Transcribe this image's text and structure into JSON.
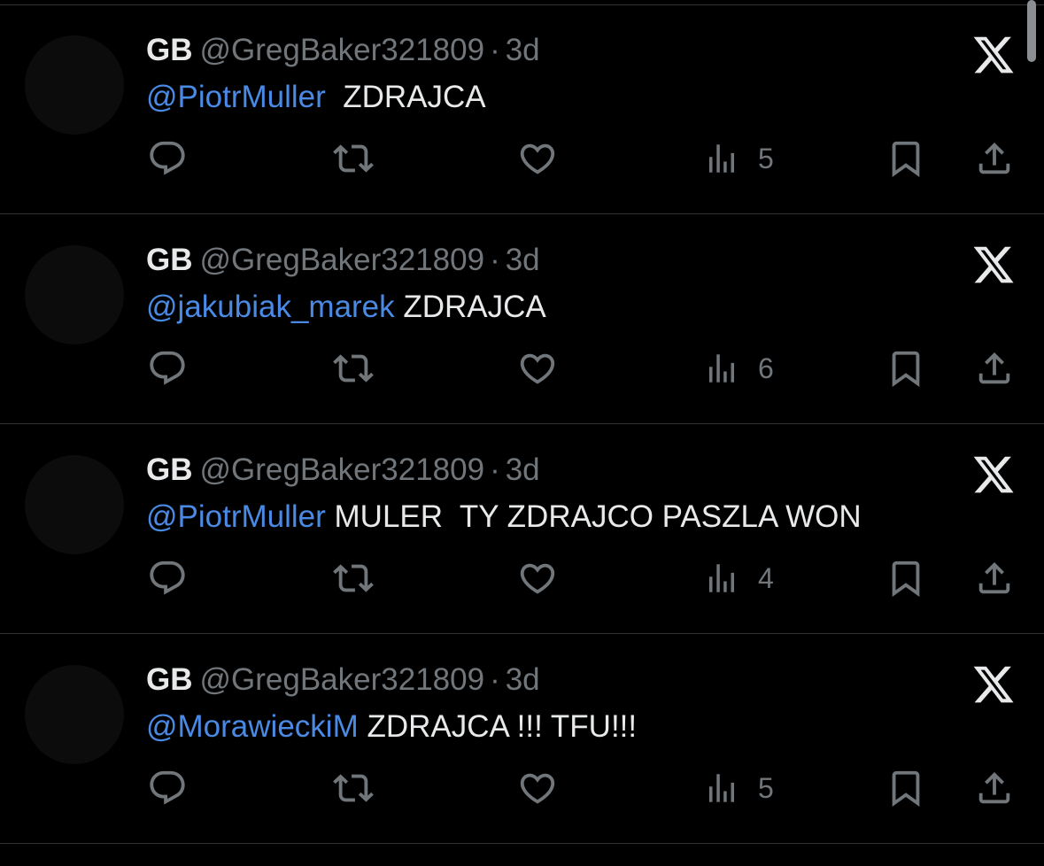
{
  "colors": {
    "background": "#000000",
    "text": "#e7e9ea",
    "muted": "#71767b",
    "mention": "#4a8ae4",
    "divider": "#2f3336"
  },
  "tweets": [
    {
      "name": "GB",
      "handle": "@GregBaker321809",
      "separator": "·",
      "time": "3d",
      "mention": "@PiotrMuller",
      "text": "  ZDRAJCA",
      "views": "5"
    },
    {
      "name": "GB",
      "handle": "@GregBaker321809",
      "separator": "·",
      "time": "3d",
      "mention": "@jakubiak_marek",
      "text": " ZDRAJCA",
      "views": "6"
    },
    {
      "name": "GB",
      "handle": "@GregBaker321809",
      "separator": "·",
      "time": "3d",
      "mention": "@PiotrMuller",
      "text": " MULER  TY ZDRAJCO PASZLA WON",
      "views": "4"
    },
    {
      "name": "GB",
      "handle": "@GregBaker321809",
      "separator": "·",
      "time": "3d",
      "mention": "@MorawieckiM",
      "text": " ZDRAJCA !!! TFU!!!",
      "views": "5"
    }
  ],
  "icons": {
    "platform": "x-logo-icon",
    "reply": "reply-icon",
    "retweet": "retweet-icon",
    "like": "heart-icon",
    "views": "views-chart-icon",
    "bookmark": "bookmark-icon",
    "share": "share-icon"
  }
}
